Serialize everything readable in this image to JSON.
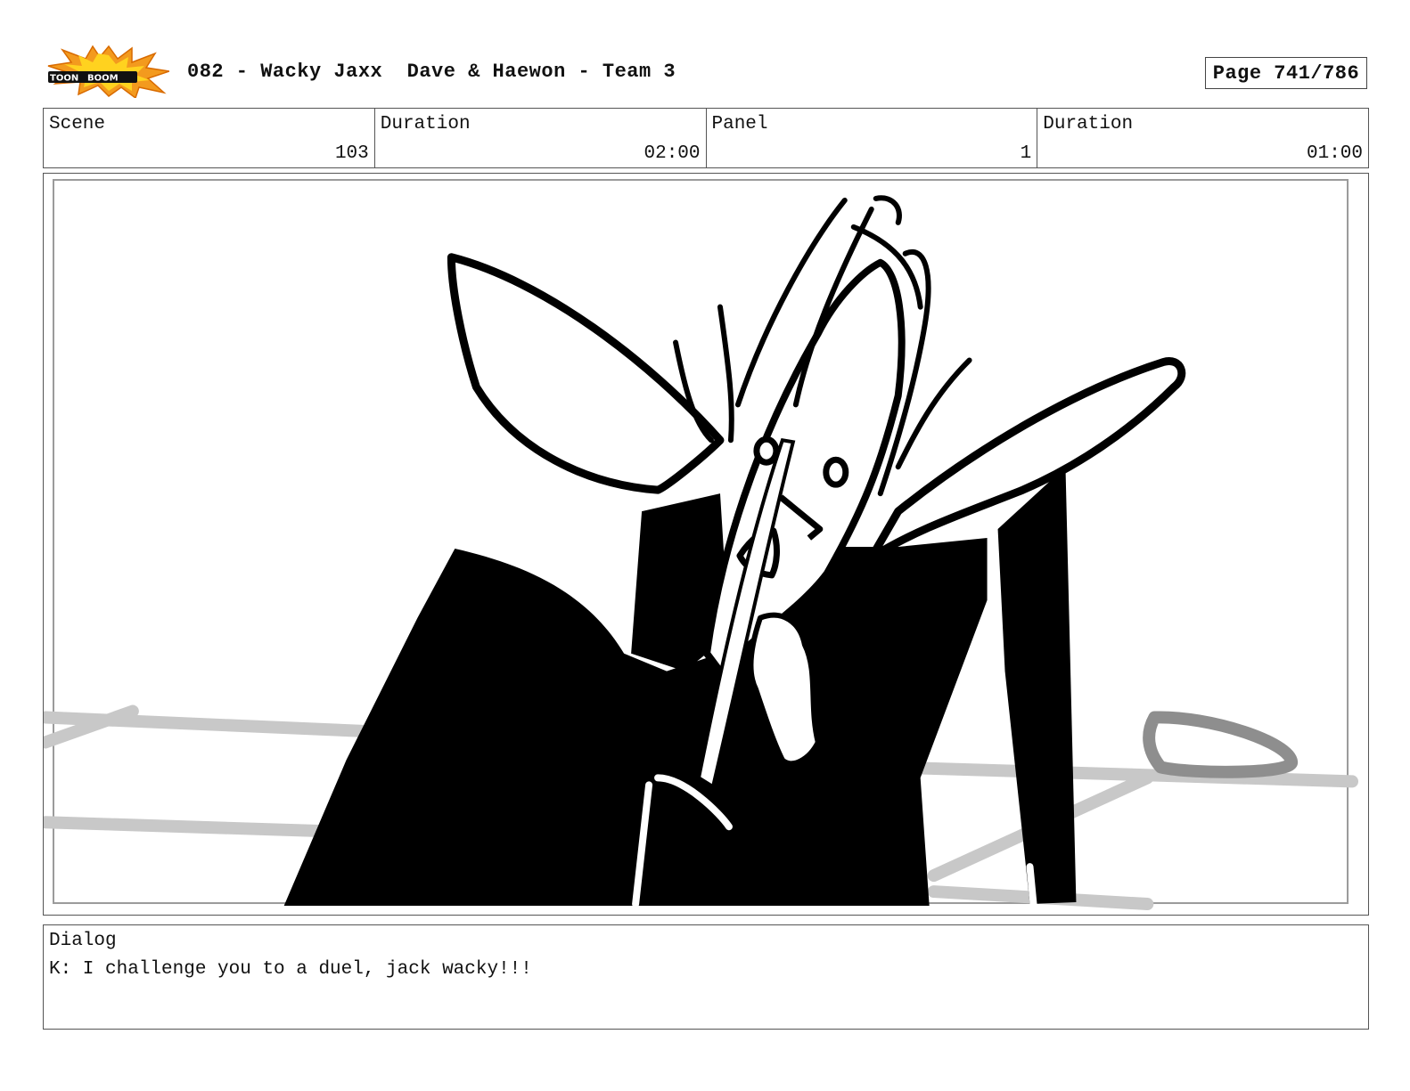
{
  "header": {
    "logo": {
      "icon": "toon-boom-logo-icon",
      "text": "TOON BOOM"
    },
    "title": "082 - Wacky Jaxx  Dave & Haewon - Team 3",
    "page": "Page 741/786"
  },
  "info": {
    "scene_label": "Scene",
    "scene_value": "103",
    "scene_duration_label": "Duration",
    "scene_duration_value": "02:00",
    "panel_label": "Panel",
    "panel_value": "1",
    "panel_duration_label": "Duration",
    "panel_duration_value": "01:00"
  },
  "dialog": {
    "label": "Dialog",
    "text": "K: I challenge you to a duel, jack wacky!!!"
  },
  "colors": {
    "ink": "#000000",
    "paper": "#ffffff",
    "floor_lines": "#c8c8c8",
    "prop_outline": "#8e8e8e",
    "logo_orange": "#f39a1e",
    "logo_yellow": "#ffd21f"
  }
}
